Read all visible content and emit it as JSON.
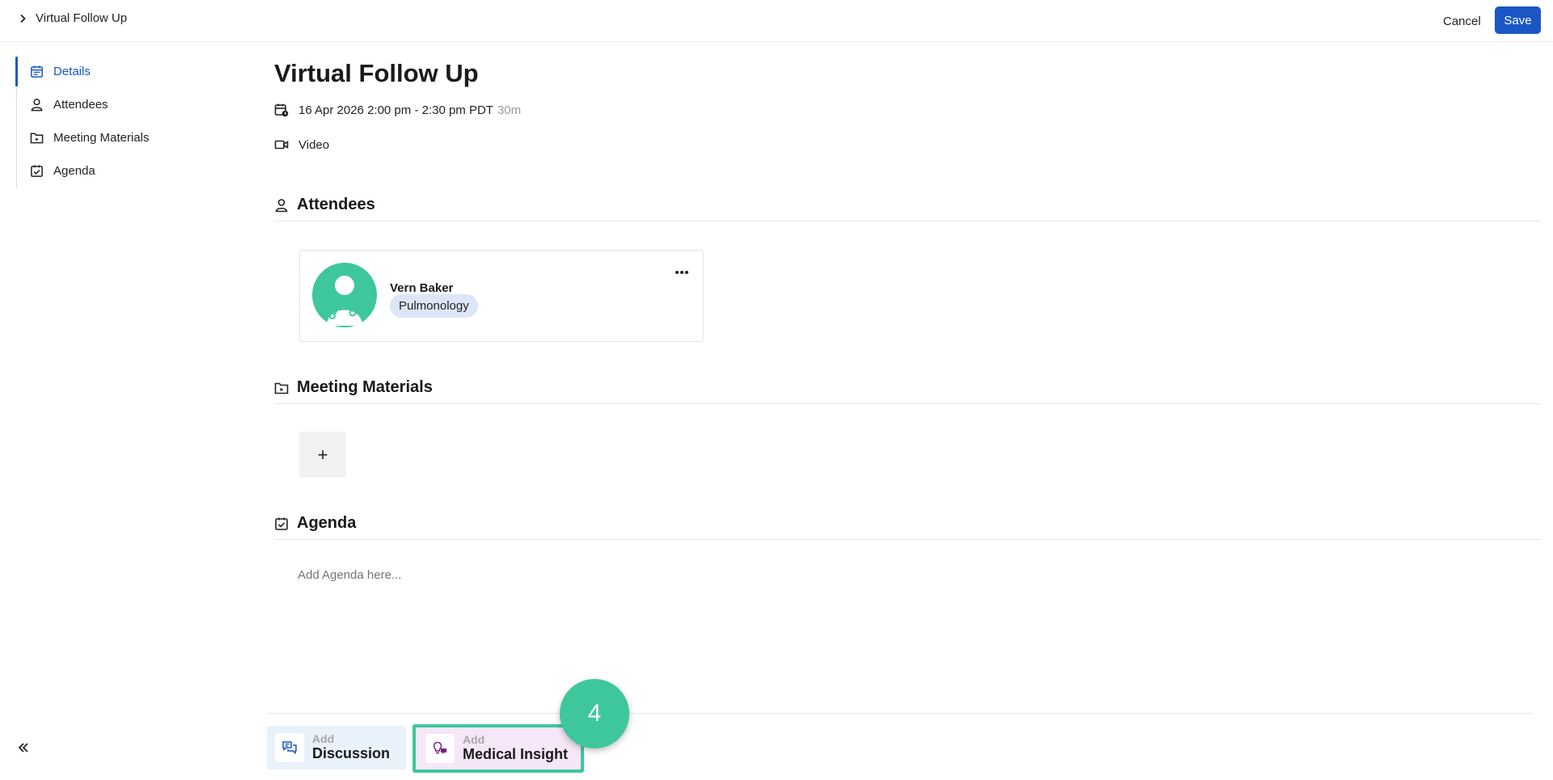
{
  "header": {
    "breadcrumb": "Virtual Follow Up",
    "cancel_label": "Cancel",
    "save_label": "Save",
    "accent_color": "#1b57c4"
  },
  "sidebar": {
    "items": [
      {
        "label": "Details",
        "icon": "calendar-icon",
        "active": true
      },
      {
        "label": "Attendees",
        "icon": "person-icon",
        "active": false
      },
      {
        "label": "Meeting Materials",
        "icon": "folder-icon",
        "active": false
      },
      {
        "label": "Agenda",
        "icon": "calendar-check-icon",
        "active": false
      }
    ],
    "collapse_icon": "double-chevron-left-icon"
  },
  "meeting": {
    "title": "Virtual Follow Up",
    "datetime": "16 Apr 2026 2:00 pm - 2:30 pm PDT",
    "duration": "30m",
    "channel": "Video"
  },
  "attendees_section": {
    "title": "Attendees",
    "attendees": [
      {
        "name": "Vern Baker",
        "specialty": "Pulmonology",
        "avatar_color": "#3ec79c"
      }
    ]
  },
  "materials_section": {
    "title": "Meeting Materials",
    "add_label": "+"
  },
  "agenda_section": {
    "title": "Agenda",
    "placeholder": "Add Agenda here..."
  },
  "actions": {
    "discussion": {
      "small": "Add",
      "big": "Discussion"
    },
    "insight": {
      "small": "Add",
      "big": "Medical Insight"
    }
  },
  "step_marker": {
    "number": "4",
    "color": "#3ec79c"
  }
}
